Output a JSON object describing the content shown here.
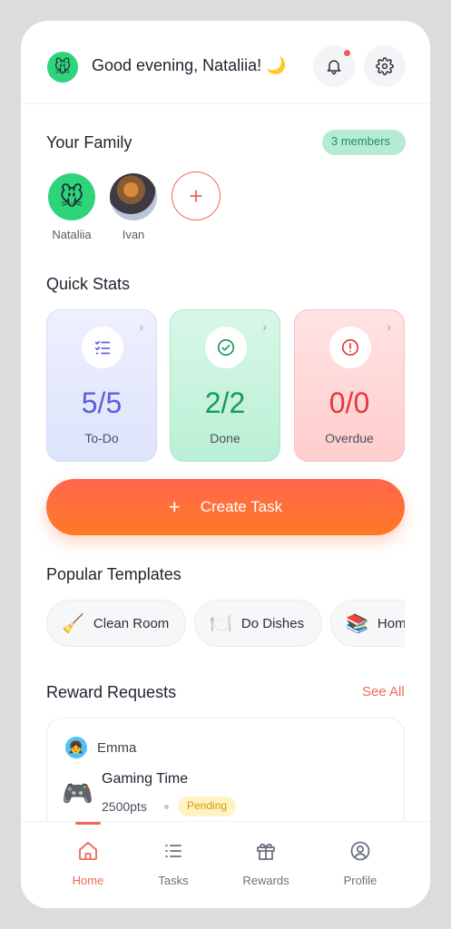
{
  "header": {
    "greeting": "Good evening, Nataliia! 🌙",
    "avatar_emoji": "🐭",
    "notification_dot": true
  },
  "family": {
    "title": "Your Family",
    "members_badge": "3 members",
    "members": [
      {
        "name": "Nataliia",
        "avatar": "🐭"
      },
      {
        "name": "Ivan",
        "avatar": "photo"
      }
    ],
    "add_symbol": "+"
  },
  "stats": {
    "title": "Quick Stats",
    "cards": [
      {
        "value": "5/5",
        "label": "To-Do"
      },
      {
        "value": "2/2",
        "label": "Done"
      },
      {
        "value": "0/0",
        "label": "Overdue"
      }
    ]
  },
  "create_task": {
    "label": "Create Task",
    "plus": "+"
  },
  "templates": {
    "title": "Popular Templates",
    "items": [
      {
        "emoji": "🧹",
        "label": "Clean Room"
      },
      {
        "emoji": "🍽️",
        "label": "Do Dishes"
      },
      {
        "emoji": "📚",
        "label": "Hom"
      }
    ]
  },
  "rewards": {
    "title": "Reward Requests",
    "see_all": "See All",
    "request": {
      "user": "Emma",
      "user_avatar": "👧",
      "emoji": "🎮",
      "title": "Gaming Time",
      "points": "2500pts",
      "status": "Pending"
    }
  },
  "tabs": [
    {
      "label": "Home",
      "icon": "home-icon",
      "active": true
    },
    {
      "label": "Tasks",
      "icon": "list-icon",
      "active": false
    },
    {
      "label": "Rewards",
      "icon": "gift-icon",
      "active": false
    },
    {
      "label": "Profile",
      "icon": "profile-icon",
      "active": false
    }
  ],
  "colors": {
    "accent": "#f0675a",
    "create_gradient_start": "#ff6650",
    "create_gradient_end": "#ff7a22",
    "todo": "#5b5fd6",
    "done": "#18995a",
    "overdue": "#e23a3a"
  }
}
